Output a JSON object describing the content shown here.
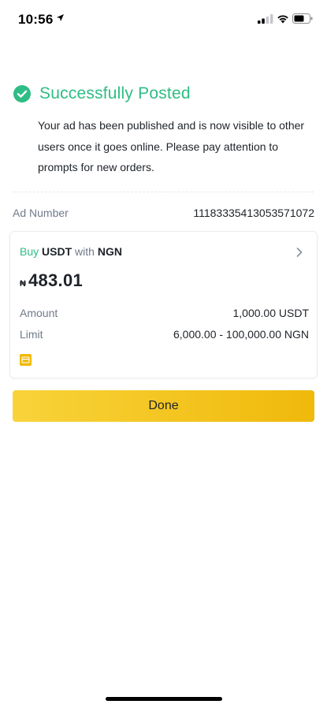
{
  "status_bar": {
    "time": "10:56"
  },
  "success": {
    "title": "Successfully Posted",
    "description": "Your ad has been published and is now visible to other users once it goes online. Please pay attention to prompts for new orders."
  },
  "ad_number": {
    "label": "Ad Number",
    "value": "11183335413053571072"
  },
  "ad_card": {
    "action": "Buy",
    "asset": "USDT",
    "with_word": "with",
    "fiat": "NGN",
    "price_symbol": "₦",
    "price": "483.01",
    "amount_label": "Amount",
    "amount_value": "1,000.00 USDT",
    "limit_label": "Limit",
    "limit_value": "6,000.00 - 100,000.00 NGN",
    "payment_icon": "bank-card-icon"
  },
  "done_button": {
    "label": "Done"
  },
  "colors": {
    "success": "#2ebd85",
    "accent": "#f0b90b",
    "text": "#1e2329",
    "muted": "#707a8a"
  }
}
